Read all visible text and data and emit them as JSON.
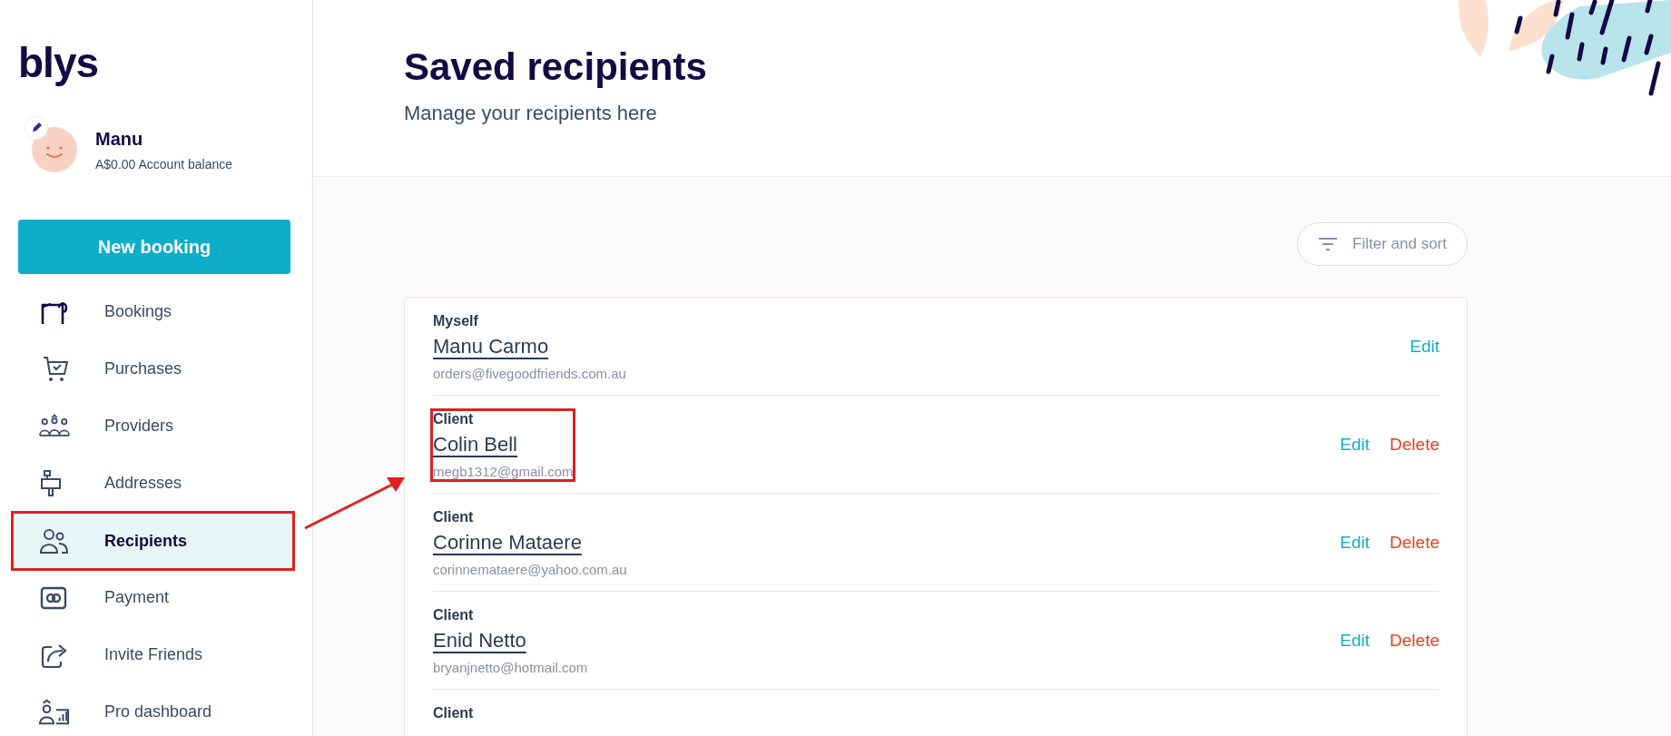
{
  "logo": "blys",
  "profile": {
    "name": "Manu",
    "balance": "A$0.00 Account balance"
  },
  "new_booking": "New booking",
  "nav": [
    {
      "label": "Bookings",
      "selected": false,
      "highlighted": false
    },
    {
      "label": "Purchases",
      "selected": false,
      "highlighted": false
    },
    {
      "label": "Providers",
      "selected": false,
      "highlighted": false
    },
    {
      "label": "Addresses",
      "selected": false,
      "highlighted": false
    },
    {
      "label": "Recipients",
      "selected": true,
      "highlighted": true
    },
    {
      "label": "Payment",
      "selected": false,
      "highlighted": false
    },
    {
      "label": "Invite Friends",
      "selected": false,
      "highlighted": false
    },
    {
      "label": "Pro dashboard",
      "selected": false,
      "highlighted": false
    }
  ],
  "header": {
    "title": "Saved recipients",
    "subtitle": "Manage your recipients here"
  },
  "filter_button": "Filter and sort",
  "recipients": [
    {
      "type": "Myself",
      "name": "Manu Carmo",
      "email": "orders@fivegoodfriends.com.au",
      "actions": [
        "Edit"
      ],
      "highlighted": false
    },
    {
      "type": "Client",
      "name": "Colin Bell",
      "email": "megb1312@gmail.com",
      "actions": [
        "Edit",
        "Delete"
      ],
      "highlighted": true
    },
    {
      "type": "Client",
      "name": "Corinne Mataere",
      "email": "corinnemataere@yahoo.com.au",
      "actions": [
        "Edit",
        "Delete"
      ],
      "highlighted": false
    },
    {
      "type": "Client",
      "name": "Enid Netto",
      "email": "bryanjnetto@hotmail.com",
      "actions": [
        "Edit",
        "Delete"
      ],
      "highlighted": false
    },
    {
      "type": "Client",
      "highlighted": false
    }
  ]
}
